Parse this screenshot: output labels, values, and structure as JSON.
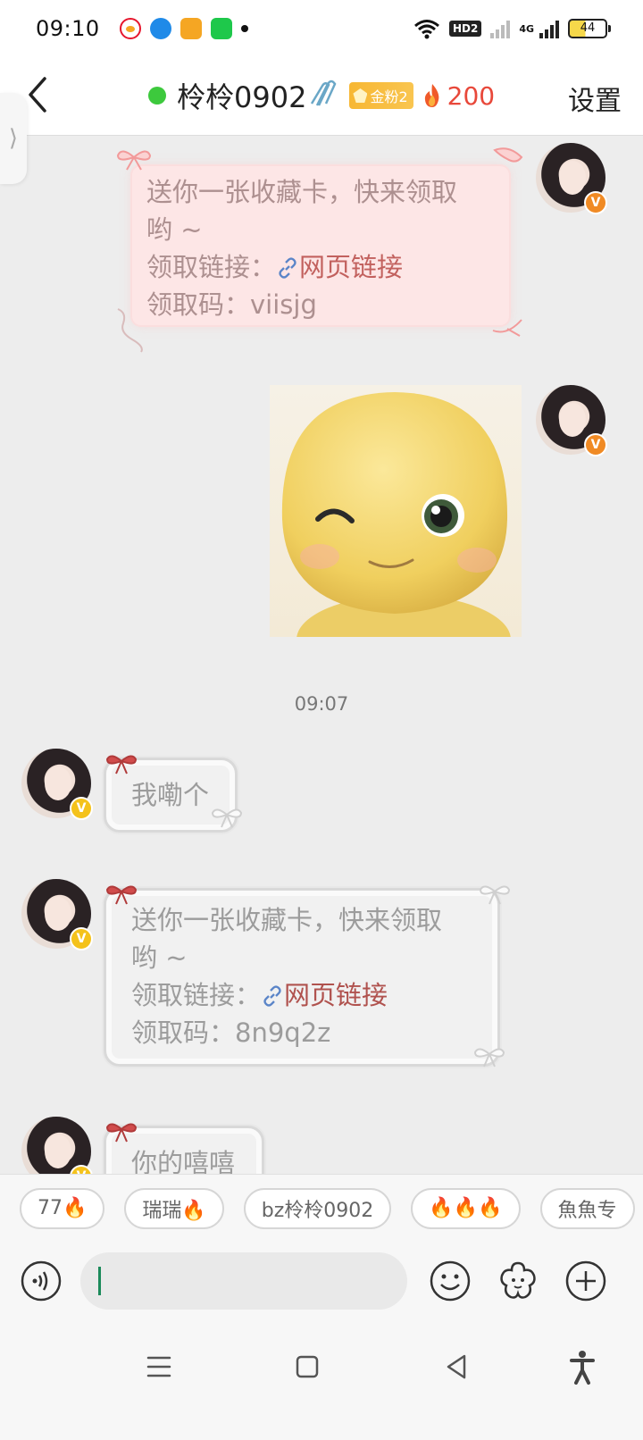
{
  "status_bar": {
    "time": "09:10",
    "hd_label": "HD2",
    "net_label": "4G",
    "battery": "44"
  },
  "header": {
    "back_icon": "chevron-left-icon",
    "title": "柃柃0902",
    "fan_badge": "金粉2",
    "fire_count": "200",
    "settings_label": "设置",
    "online_color": "#3dc93d"
  },
  "messages": {
    "m1": {
      "line1": "送你一张收藏卡，快来领取",
      "line2": "哟 ~",
      "link_label": "领取链接：",
      "link_text": "网页链接",
      "code_label": "领取码：",
      "code": "viisjg"
    },
    "timestamp": "09:07",
    "m3": {
      "text": "我嘞个"
    },
    "m4": {
      "line1": "送你一张收藏卡，快来领取",
      "line2": "哟 ~",
      "link_label": "领取链接：",
      "link_text": "网页链接",
      "code_label": "领取码：",
      "code": "8n9q2z"
    },
    "m5": {
      "text": "你的嘻嘻"
    }
  },
  "quick_replies": [
    "77🔥",
    "瑞瑞🔥",
    "bz柃柃0902",
    "🔥🔥🔥",
    "魚魚专"
  ],
  "input": {
    "placeholder": ""
  },
  "colors": {
    "link": "#b0524e",
    "fire": "#e8483a",
    "fan_badge": "#f7b733"
  }
}
